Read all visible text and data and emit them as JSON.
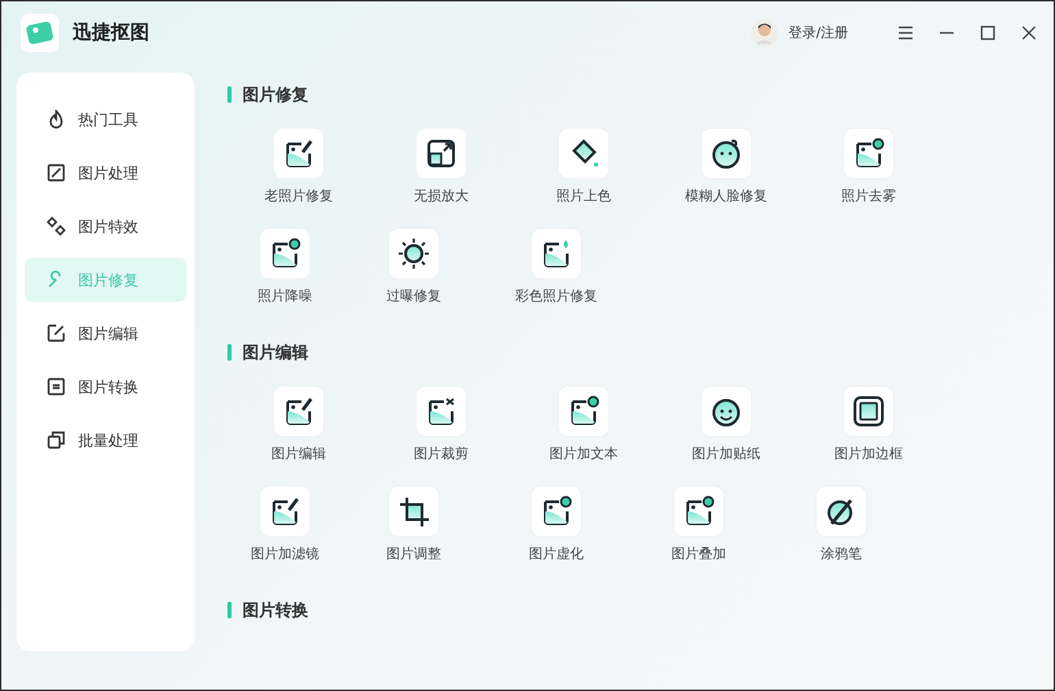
{
  "app": {
    "title": "迅捷抠图",
    "login": "登录/注册"
  },
  "sidebar": {
    "items": [
      {
        "label": "热门工具",
        "selected": false
      },
      {
        "label": "图片处理",
        "selected": false
      },
      {
        "label": "图片特效",
        "selected": false
      },
      {
        "label": "图片修复",
        "selected": true
      },
      {
        "label": "图片编辑",
        "selected": false
      },
      {
        "label": "图片转换",
        "selected": false
      },
      {
        "label": "批量处理",
        "selected": false
      }
    ]
  },
  "sections": [
    {
      "title": "图片修复",
      "rows": [
        [
          "老照片修复",
          "无损放大",
          "照片上色",
          "模糊人脸修复",
          "照片去雾"
        ],
        [
          "照片降噪",
          "过曝修复",
          "彩色照片修复"
        ]
      ]
    },
    {
      "title": "图片编辑",
      "rows": [
        [
          "图片编辑",
          "图片裁剪",
          "图片加文本",
          "图片加贴纸",
          "图片加边框"
        ],
        [
          "图片加滤镜",
          "图片调整",
          "图片虚化",
          "图片叠加",
          "涂鸦笔"
        ]
      ]
    },
    {
      "title": "图片转换"
    }
  ]
}
